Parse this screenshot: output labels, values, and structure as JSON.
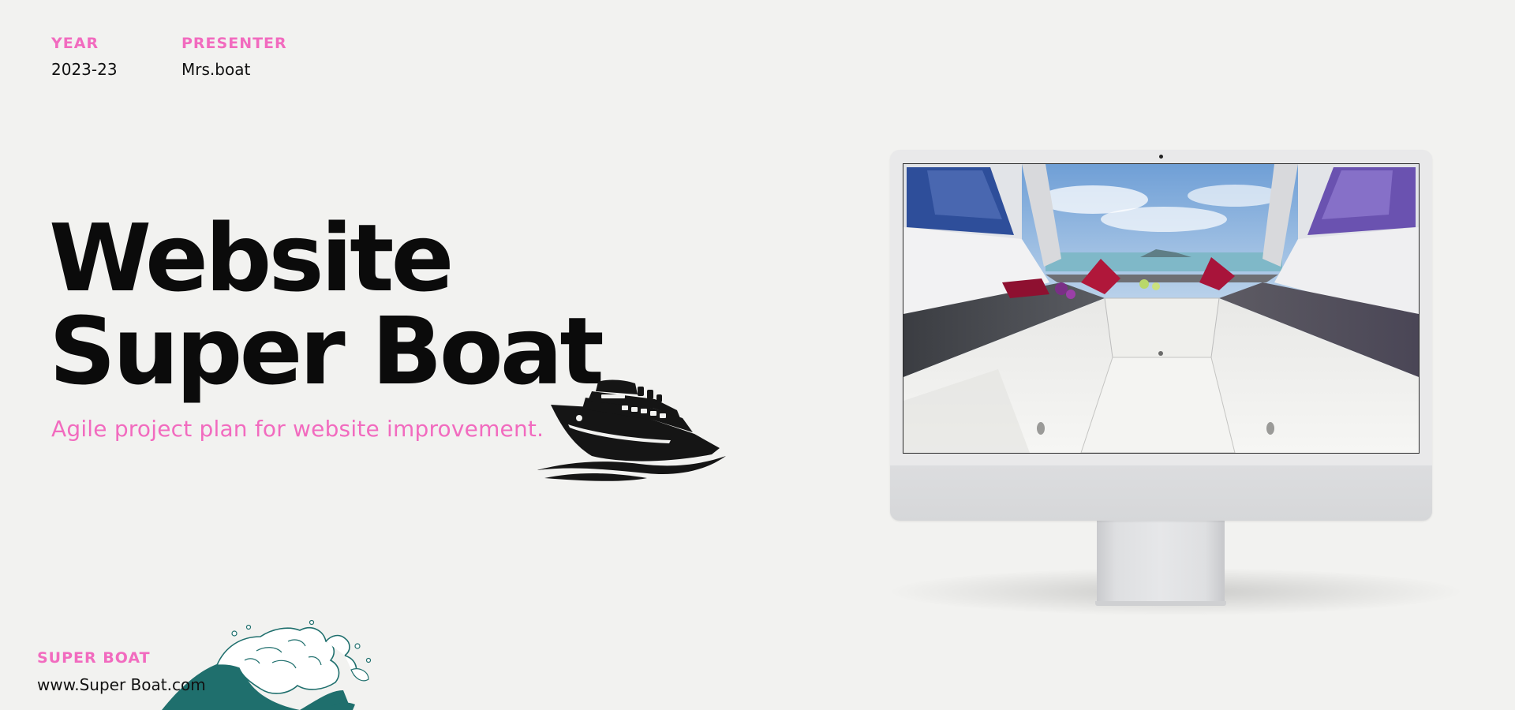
{
  "meta": {
    "year_label": "YEAR",
    "year_value": "2023-23",
    "presenter_label": "PRESENTER",
    "presenter_value": "Mrs.boat"
  },
  "hero": {
    "title_line_1": "Website",
    "title_line_2": "Super Boat",
    "subtitle": "Agile project plan for website improvement."
  },
  "footer": {
    "brand_label": "SUPER BOAT",
    "brand_url": "www.Super Boat.com"
  },
  "icons": {
    "ship": "ship-icon",
    "wave": "wave-illustration",
    "monitor": "desktop-monitor-mockup"
  },
  "colors": {
    "accent_pink": "#f26bbf",
    "title_black": "#0b0b0b",
    "background": "#f2f2f0",
    "wave_teal": "#1f6f6d"
  }
}
